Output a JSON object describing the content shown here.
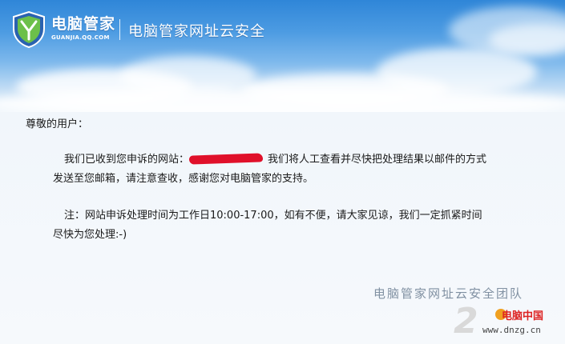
{
  "header": {
    "brand_name": "电脑管家",
    "brand_url": "GUANJIA.QQ.COM",
    "title": "电脑管家网址云安全"
  },
  "letter": {
    "greeting": "尊敬的用户：",
    "p1_before": "我们已收到您申诉的网站：",
    "p1_after": "我们将人工查看并尽快把处理结果以邮件的方式",
    "p1_line2": "发送至您邮箱，请注意查收，感谢您对电脑管家的支持。",
    "p2_line1": "注：网站申诉处理时间为工作日10:00-17:00，如有不便，请大家见谅，我们一定抓紧时间",
    "p2_line2": "尽快为您处理:-)",
    "signature": "电脑管家网址云安全团队"
  },
  "watermark": {
    "number": "2",
    "site_name": "电脑中国",
    "url": "www.dnzg.cn"
  },
  "colors": {
    "sky_top": "#2f86d8",
    "redaction": "#e0102a",
    "signature": "#8090a2"
  },
  "icons": {
    "logo": "shield-icon"
  }
}
